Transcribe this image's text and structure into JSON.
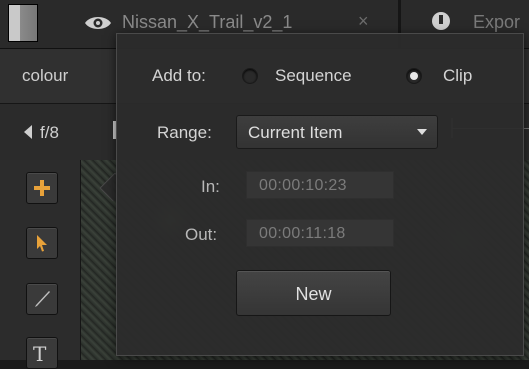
{
  "header": {
    "clip_name": "Nissan_X_Trail_v2_1",
    "close_glyph": "×",
    "export_label": "Expor"
  },
  "tabs": {
    "colour": "colour"
  },
  "transport": {
    "fstop": "f/8"
  },
  "tools": [
    {
      "icon": "add-icon"
    },
    {
      "icon": "pointer-icon"
    },
    {
      "icon": "brush-icon"
    },
    {
      "icon": "text-icon",
      "glyph": "T"
    }
  ],
  "popup": {
    "add_to_label": "Add to:",
    "options": [
      {
        "label": "Sequence",
        "selected": false
      },
      {
        "label": "Clip",
        "selected": true
      }
    ],
    "range_label": "Range:",
    "range_value": "Current Item",
    "in_label": "In:",
    "in_value": "00:00:10:23",
    "out_label": "Out:",
    "out_value": "00:00:11:18",
    "new_button": "New"
  },
  "colors": {
    "accent_orange": "#e8a23a",
    "panel": "#2c2c2c"
  }
}
